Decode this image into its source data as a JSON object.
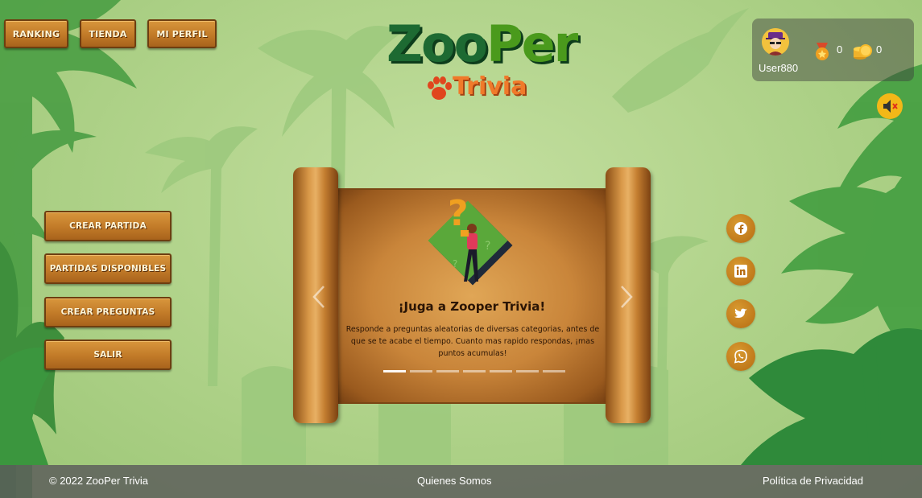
{
  "nav": {
    "ranking": "RANKING",
    "tienda": "TIENDA",
    "perfil": "MI PERFIL"
  },
  "logo": {
    "zoo": "Zoo",
    "per": "Per",
    "trivia": "Trivia"
  },
  "user": {
    "name": "User880",
    "trophies": "0",
    "coins": "0"
  },
  "menu": {
    "crear_partida": "CREAR PARTIDA",
    "partidas_disponibles": "PARTIDAS DISPONIBLES",
    "crear_preguntas": "CREAR PREGUNTAS",
    "salir": "SALIR"
  },
  "carousel": {
    "title": "¡Juga a Zooper Trivia!",
    "text": "Responde a preguntas aleatorias de diversas categorias, antes de que se te acabe el tiempo. Cuanto mas rapido respondas, ¡mas puntos acumulas!",
    "slide_count": 7,
    "active_slide": 1
  },
  "footer": {
    "copyright": "© 2022 ZooPer Trivia",
    "about": "Quienes Somos",
    "privacy": "Política de Privacidad"
  },
  "colors": {
    "wood": "#c17a28",
    "accent_orange": "#f07a2a",
    "logo_green": "#1d6a32",
    "social_bg": "#b66c12"
  }
}
